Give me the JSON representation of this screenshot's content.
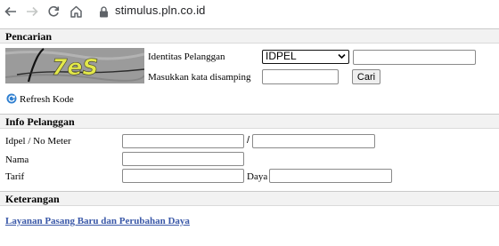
{
  "browser": {
    "url": "stimulus.pln.co.id"
  },
  "pencarian": {
    "title": "Pencarian",
    "captcha_text": "7eS",
    "identitas_label": "Identitas Pelanggan",
    "identitas_select_value": "IDPEL",
    "identitas_input_value": "",
    "kata_label": "Masukkan kata disamping",
    "kata_input_value": "",
    "cari_button": "Cari",
    "refresh_label": "Refresh Kode"
  },
  "info": {
    "title": "Info Pelanggan",
    "idpel_label": "Idpel / No Meter",
    "separator": "/",
    "nama_label": "Nama",
    "tarif_label": "Tarif",
    "daya_label": "Daya"
  },
  "keterangan": {
    "title": "Keterangan",
    "link_text": "Layanan Pasang Baru dan Perubahan Daya"
  },
  "colors": {
    "link": "#3a58a8",
    "section_bg": "#f2f2f2"
  },
  "icons": [
    "back-arrow-icon",
    "forward-arrow-icon",
    "reload-icon",
    "home-icon",
    "lock-icon",
    "refresh-icon"
  ]
}
